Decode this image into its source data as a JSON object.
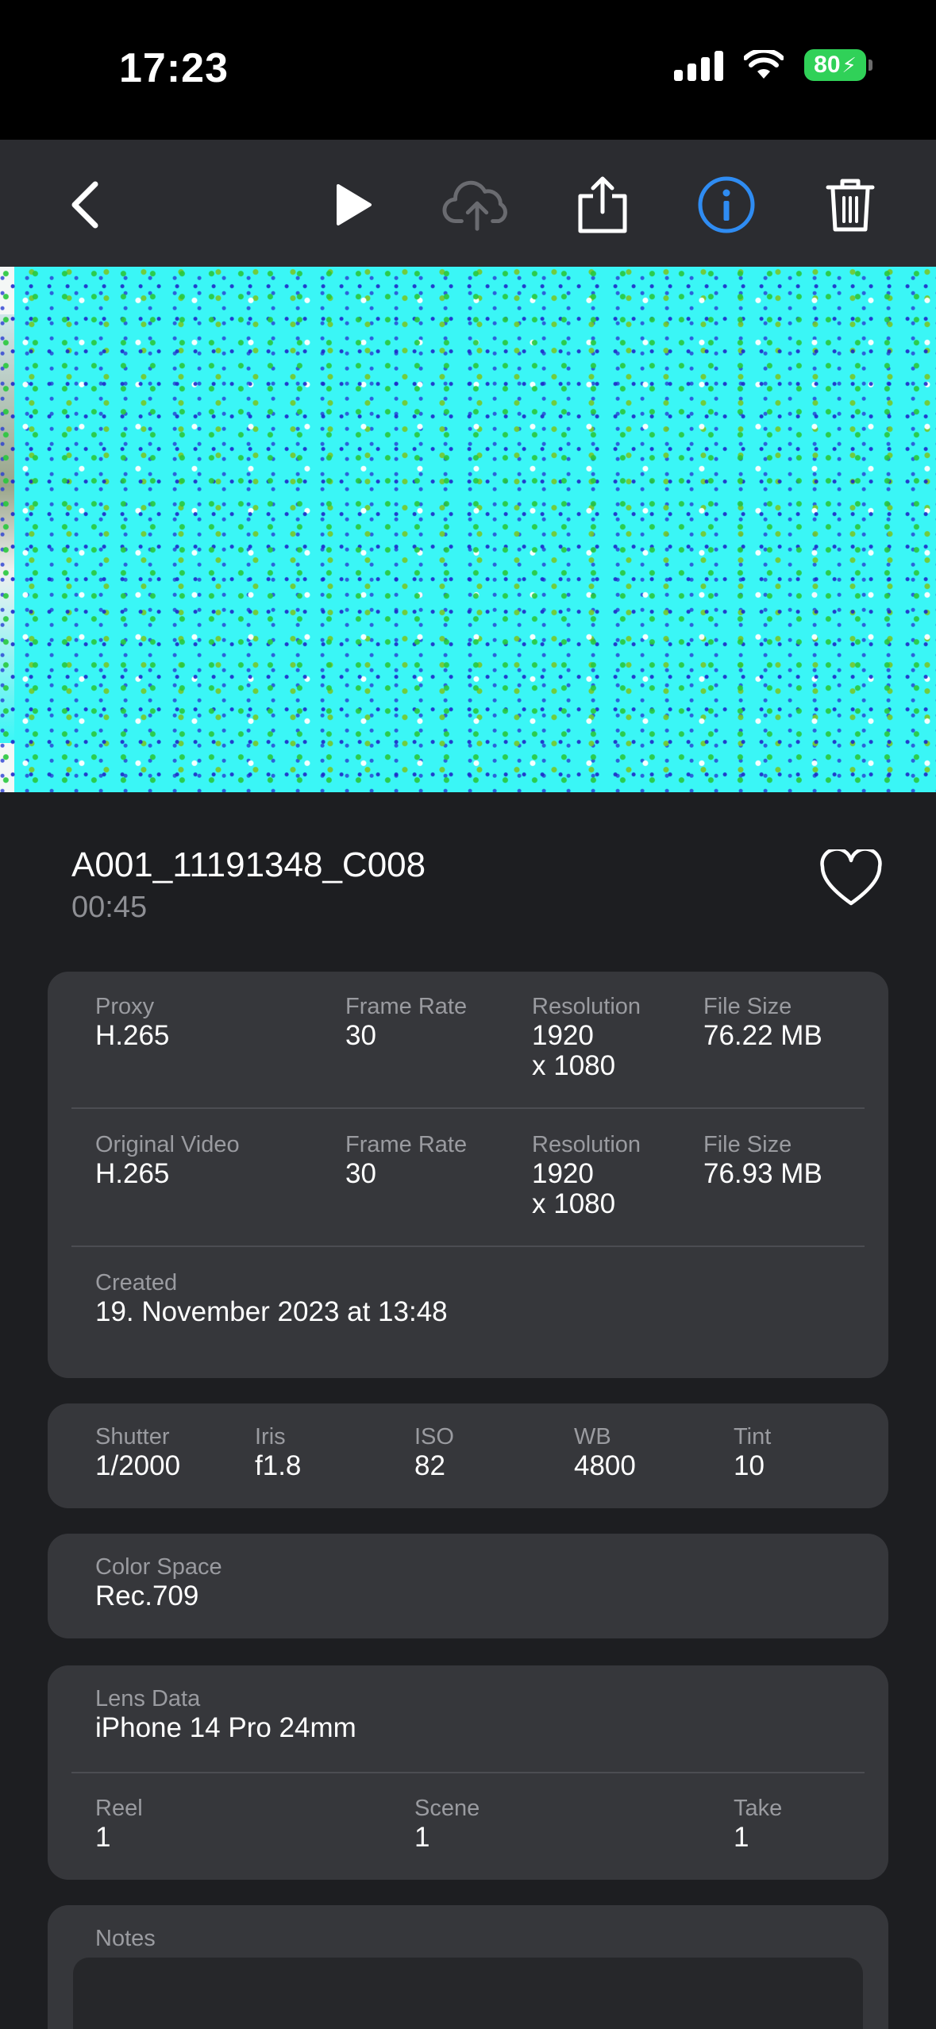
{
  "status": {
    "time": "17:23",
    "battery": "80"
  },
  "toolbar": {
    "icons": [
      "back-icon",
      "play-icon",
      "cloud-upload-icon",
      "share-icon",
      "info-icon",
      "trash-icon"
    ],
    "active_color": "#2f8cf2",
    "disabled_color": "#6a6b70"
  },
  "clip": {
    "name": "A001_11191348_C008",
    "duration": "00:45",
    "favorite": false
  },
  "proxy": {
    "type_label": "Proxy",
    "type_value": "H.265",
    "fps_label": "Frame Rate",
    "fps_value": "30",
    "res_label": "Resolution",
    "res_value_1": "1920",
    "res_value_2": "x 1080",
    "size_label": "File Size",
    "size_value": "76.22 MB"
  },
  "original": {
    "type_label": "Original Video",
    "type_value": "H.265",
    "fps_label": "Frame Rate",
    "fps_value": "30",
    "res_label": "Resolution",
    "res_value_1": "1920",
    "res_value_2": "x 1080",
    "size_label": "File Size",
    "size_value": "76.93 MB"
  },
  "created": {
    "label": "Created",
    "value": "19. November 2023 at 13:48"
  },
  "camera": [
    {
      "label": "Shutter",
      "value": "1/2000"
    },
    {
      "label": "Iris",
      "value": "f1.8"
    },
    {
      "label": "ISO",
      "value": "82"
    },
    {
      "label": "WB",
      "value": "4800"
    },
    {
      "label": "Tint",
      "value": "10"
    }
  ],
  "color_space": {
    "label": "Color Space",
    "value": "Rec.709"
  },
  "lens": {
    "label": "Lens Data",
    "value": "iPhone 14 Pro 24mm"
  },
  "slate": [
    {
      "label": "Reel",
      "value": "1"
    },
    {
      "label": "Scene",
      "value": "1"
    },
    {
      "label": "Take",
      "value": "1"
    }
  ],
  "notes": {
    "label": "Notes",
    "value": ""
  }
}
